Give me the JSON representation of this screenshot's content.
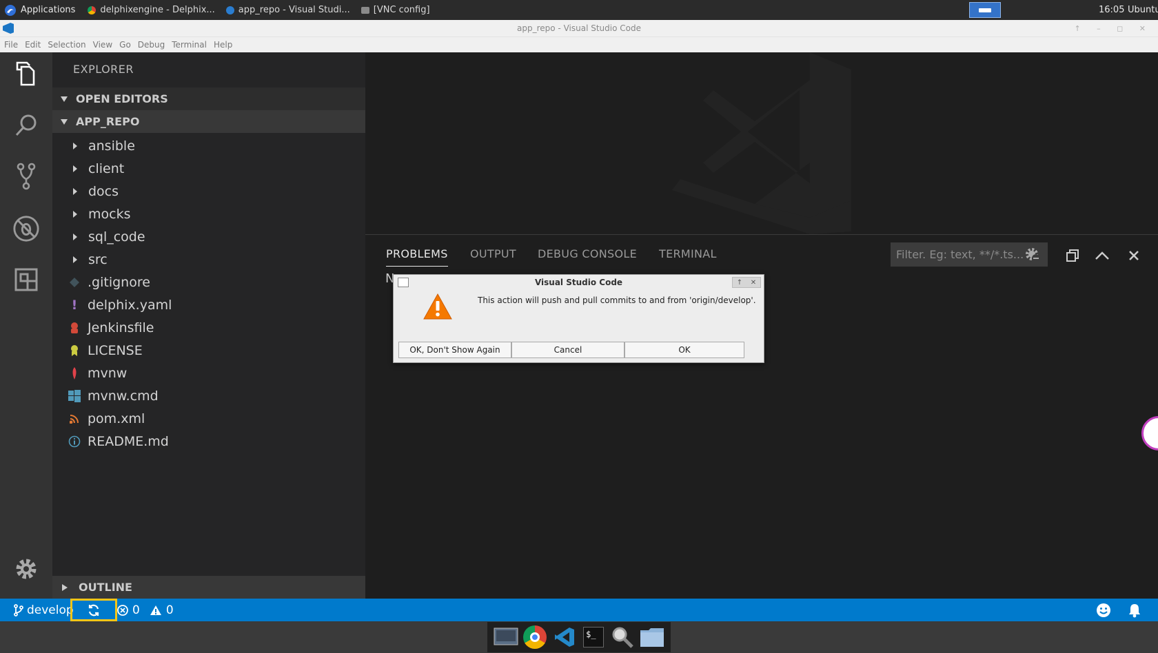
{
  "taskbar": {
    "applications_label": "Applications",
    "tasks": [
      "delphixengine - Delphix...",
      "app_repo - Visual Studi...",
      "[VNC config]"
    ],
    "clock": "16:05",
    "user": "Ubuntu"
  },
  "window": {
    "title": "app_repo - Visual Studio Code",
    "menu": [
      "File",
      "Edit",
      "Selection",
      "View",
      "Go",
      "Debug",
      "Terminal",
      "Help"
    ]
  },
  "sidebar": {
    "title": "EXPLORER",
    "open_editors": "OPEN EDITORS",
    "repo": "APP_REPO",
    "folders": [
      "ansible",
      "client",
      "docs",
      "mocks",
      "sql_code",
      "src"
    ],
    "files": [
      ".gitignore",
      "delphix.yaml",
      "Jenkinsfile",
      "LICENSE",
      "mvnw",
      "mvnw.cmd",
      "pom.xml",
      "README.md"
    ],
    "outline": "OUTLINE"
  },
  "panel": {
    "tabs": [
      "PROBLEMS",
      "OUTPUT",
      "DEBUG CONSOLE",
      "TERMINAL"
    ],
    "filter_placeholder": "Filter. Eg: text, **/*.ts...",
    "partial_text": "N"
  },
  "dialog": {
    "title": "Visual Studio Code",
    "message": "This action will push and pull commits to and from 'origin/develop'.",
    "buttons": [
      "OK, Don't Show Again",
      "Cancel",
      "OK"
    ]
  },
  "statusbar": {
    "branch": "develop",
    "errors": "0",
    "warnings": "0"
  },
  "colors": {
    "accent": "#007acc",
    "highlight_box": "#f5c518"
  }
}
